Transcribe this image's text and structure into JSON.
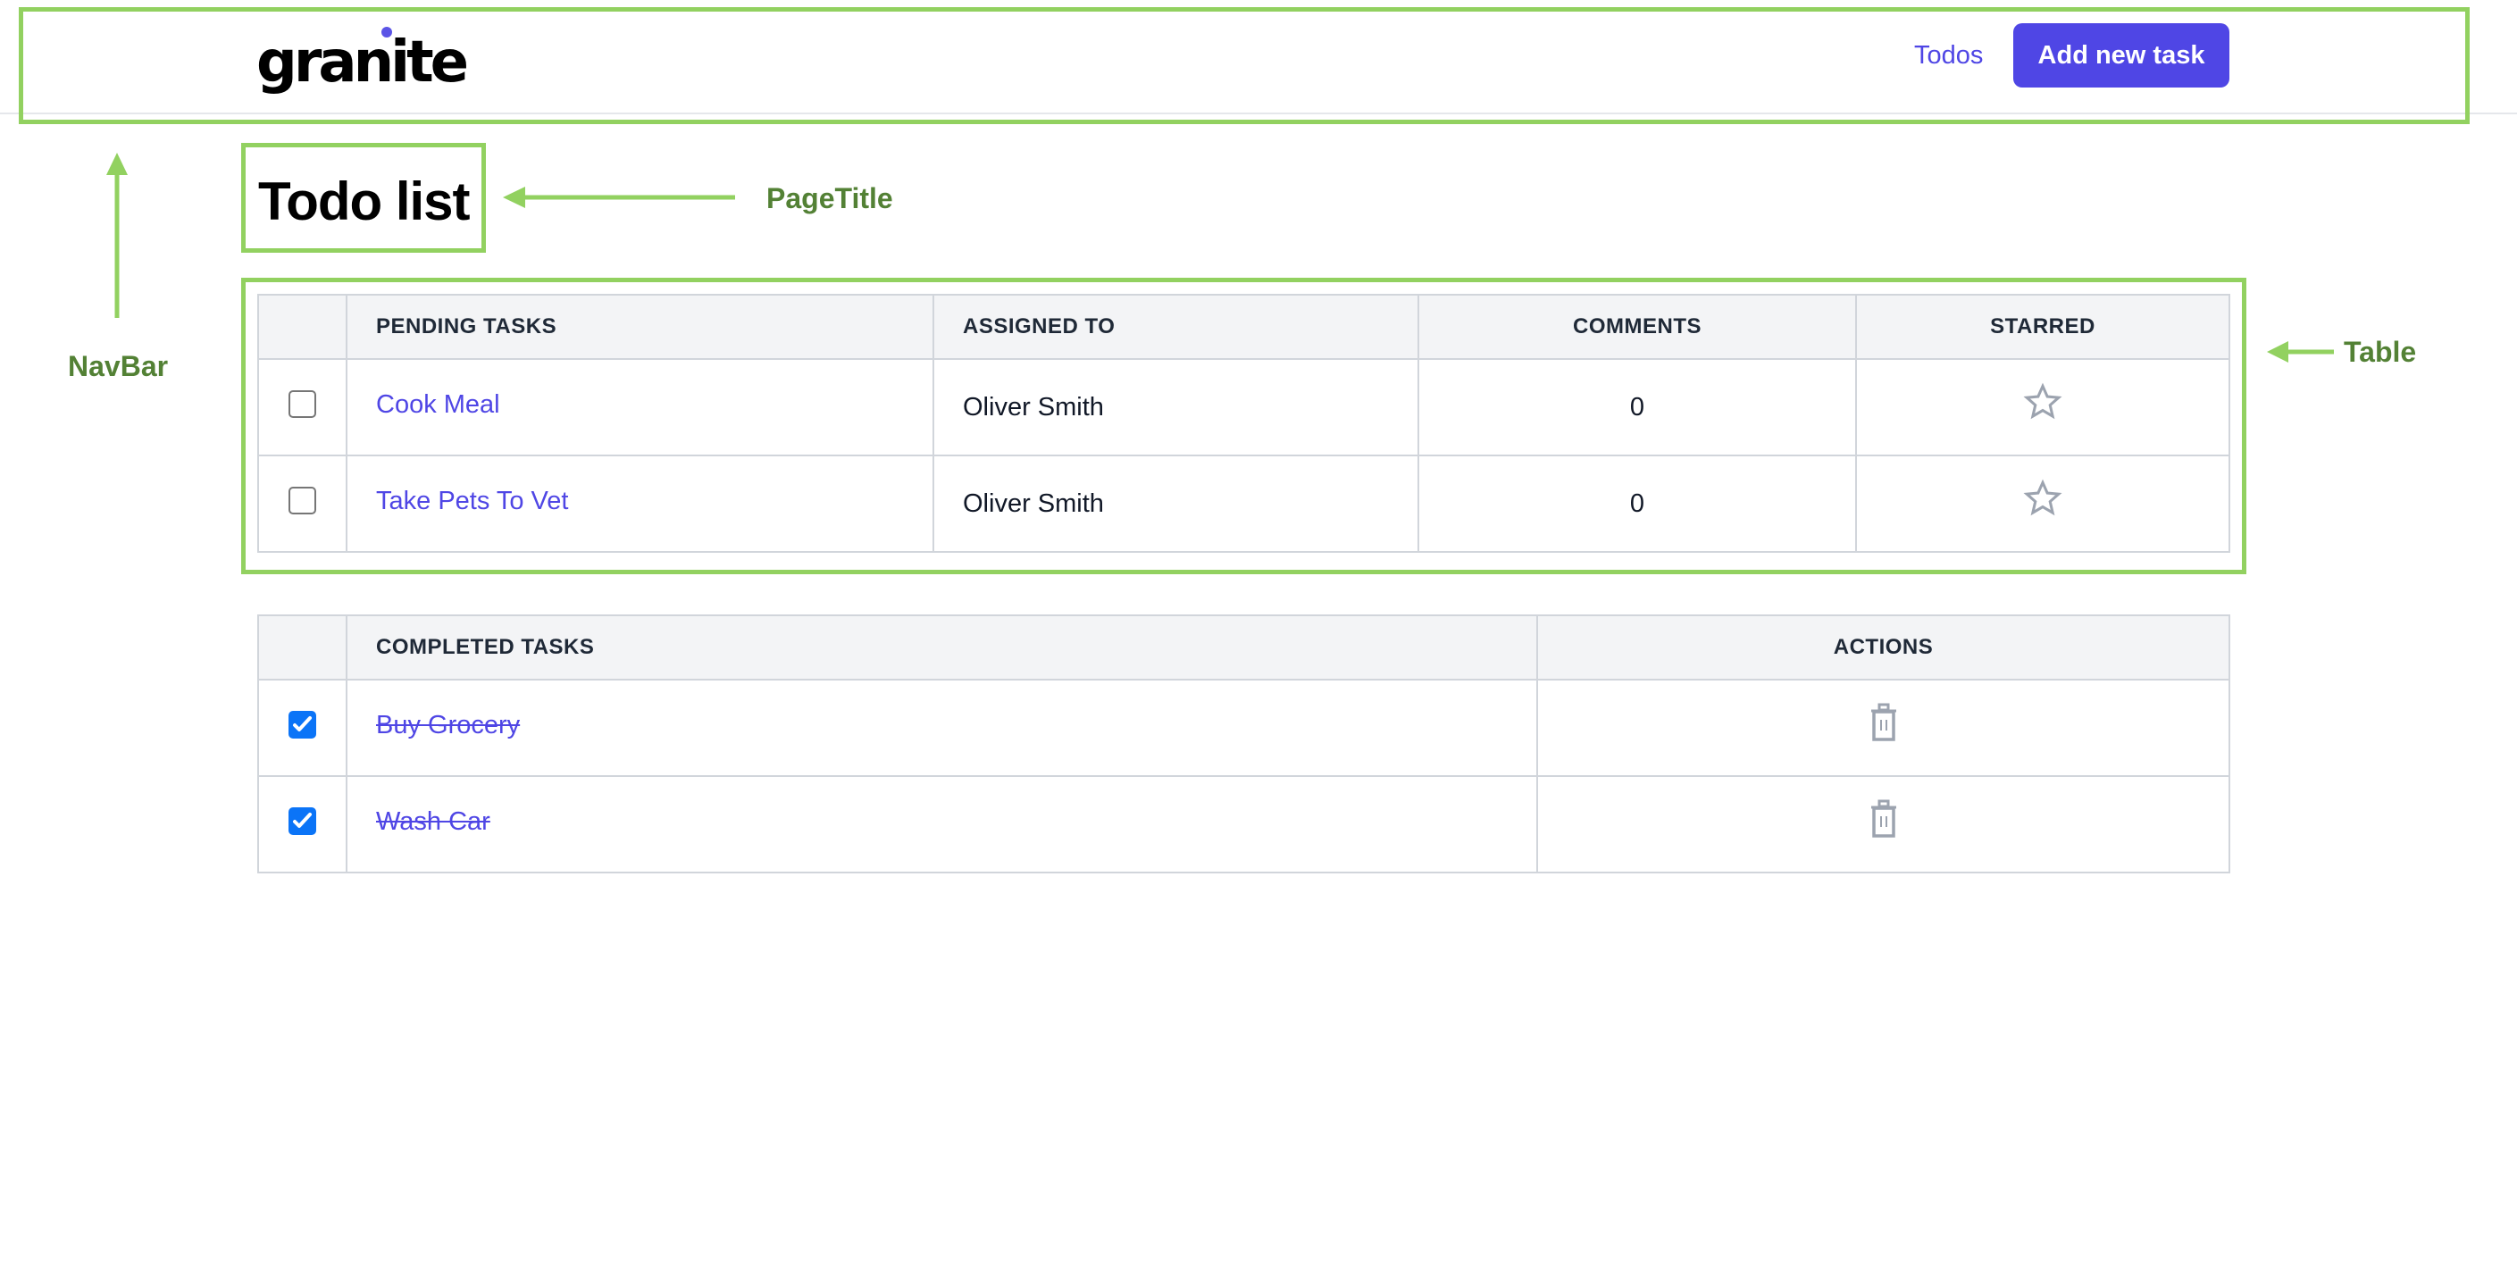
{
  "navbar": {
    "logo_text": "granite",
    "links": [
      {
        "label": "Todos"
      }
    ],
    "add_button_label": "Add new task"
  },
  "page": {
    "title": "Todo list"
  },
  "pending_table": {
    "columns": [
      "",
      "Pending Tasks",
      "Assigned To",
      "Comments",
      "Starred"
    ],
    "rows": [
      {
        "checked": false,
        "title": "Cook Meal",
        "assigned_to": "Oliver Smith",
        "comments": "0",
        "starred": false,
        "star_icon": "star-outline-icon"
      },
      {
        "checked": false,
        "title": "Take Pets To Vet",
        "assigned_to": "Oliver Smith",
        "comments": "0",
        "starred": false,
        "star_icon": "star-outline-icon"
      }
    ]
  },
  "completed_table": {
    "columns": [
      "",
      "Completed Tasks",
      "Actions"
    ],
    "rows": [
      {
        "checked": true,
        "title": "Buy Grocery",
        "action_icon": "trash-icon"
      },
      {
        "checked": true,
        "title": "Wash Car",
        "action_icon": "trash-icon"
      }
    ]
  },
  "annotations": [
    {
      "label": "NavBar",
      "target": "navbar"
    },
    {
      "label": "PageTitle",
      "target": "page-title"
    },
    {
      "label": "Table",
      "target": "pending-table"
    }
  ],
  "colors": {
    "brand": "#4f46e5",
    "annotation_outline": "#92d160",
    "annotation_text": "#538135",
    "checkbox_checked": "#0b74f7",
    "icon_gray": "#9ca3af"
  }
}
